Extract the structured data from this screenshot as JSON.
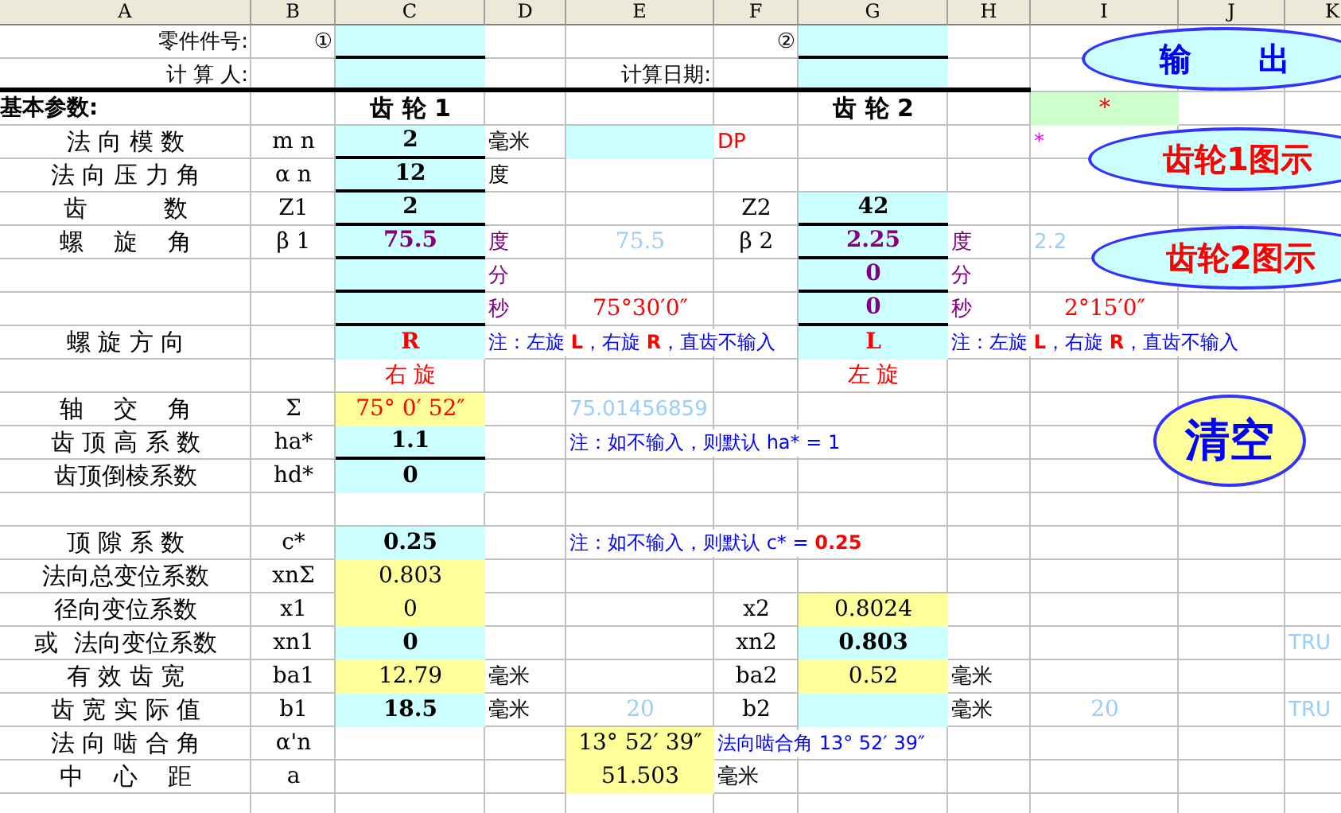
{
  "columns": [
    "A",
    "B",
    "C",
    "D",
    "E",
    "F",
    "G",
    "H",
    "I",
    "J",
    "K"
  ],
  "rows": [
    {
      "cells": [
        {
          "kind": "caption",
          "text": "零件件号:"
        },
        {
          "kind": "caption",
          "text": "①"
        },
        {
          "input": true,
          "ruled": true
        },
        null,
        null,
        {
          "kind": "caption",
          "text": "②"
        },
        {
          "input": true,
          "ruled": true
        }
      ]
    },
    {
      "thick": true,
      "cells": [
        {
          "kind": "caption",
          "text": "计 算 人:"
        },
        null,
        {
          "input": true
        },
        null,
        {
          "kind": "caption",
          "text": "计算日期:"
        },
        null,
        {
          "input": true
        }
      ]
    },
    {
      "cells": [
        {
          "kind": "heading",
          "text": "基本参数:"
        },
        null,
        {
          "kind": "title",
          "text": "齿 轮 1"
        },
        null,
        null,
        null,
        {
          "kind": "title",
          "text": "齿 轮 2"
        },
        null,
        {
          "kind": "value",
          "highlighted": true,
          "color": "#ff0000",
          "text": "*"
        }
      ]
    },
    {
      "cells": [
        {
          "kind": "label",
          "text": "法 向 模 数"
        },
        {
          "kind": "symbol",
          "text": "m n"
        },
        {
          "kind": "value",
          "input": true,
          "ruled": true,
          "bold": true,
          "text": "2"
        },
        {
          "kind": "unit",
          "text": "毫米"
        },
        {
          "input": true
        },
        {
          "kind": "unit",
          "color": "#ff0000",
          "text": "DP"
        },
        null,
        null,
        {
          "kind": "unit",
          "color": "#ff00ff",
          "text": "*"
        }
      ]
    },
    {
      "cells": [
        {
          "kind": "label",
          "text": "法 向 压 力 角"
        },
        {
          "kind": "symbol",
          "text": "α n"
        },
        {
          "kind": "value",
          "input": true,
          "ruled": true,
          "bold": true,
          "text": "12"
        },
        {
          "kind": "unit",
          "text": "度"
        }
      ]
    },
    {
      "cells": [
        {
          "kind": "label",
          "text": "齿          数"
        },
        {
          "kind": "symbol",
          "text": "Z1"
        },
        {
          "kind": "value",
          "input": true,
          "ruled": true,
          "bold": true,
          "text": "2"
        },
        null,
        null,
        {
          "kind": "symbol",
          "text": "Z2"
        },
        {
          "kind": "value",
          "input": true,
          "ruled": true,
          "bold": true,
          "text": "42"
        }
      ]
    },
    {
      "cells": [
        {
          "kind": "label",
          "text": "螺    旋    角"
        },
        {
          "kind": "symbol",
          "text": "β 1"
        },
        {
          "kind": "value",
          "input": true,
          "ruled": true,
          "bold": true,
          "color": "#800080",
          "text": "75.5"
        },
        {
          "kind": "unit",
          "color": "#800080",
          "text": "度"
        },
        {
          "kind": "value",
          "color": "#99ccff",
          "text": "75.5"
        },
        {
          "kind": "symbol",
          "text": "β 2"
        },
        {
          "kind": "value",
          "input": true,
          "ruled": true,
          "bold": true,
          "color": "#800080",
          "text": "2.25"
        },
        {
          "kind": "unit",
          "color": "#800080",
          "text": "度"
        },
        {
          "kind": "overflow",
          "color": "#99ccff",
          "text": "2.2"
        }
      ]
    },
    {
      "cells": [
        null,
        null,
        {
          "input": true,
          "ruled": true
        },
        {
          "kind": "unit",
          "color": "#800080",
          "text": "分"
        },
        null,
        null,
        {
          "kind": "value",
          "input": true,
          "ruled": true,
          "bold": true,
          "color": "#800080",
          "text": "0"
        },
        {
          "kind": "unit",
          "color": "#800080",
          "text": "分"
        }
      ]
    },
    {
      "cells": [
        null,
        null,
        {
          "input": true,
          "ruled": true
        },
        {
          "kind": "unit",
          "color": "#800080",
          "text": "秒"
        },
        {
          "kind": "value",
          "color": "#ff0000",
          "text": "75°30′0″"
        },
        null,
        {
          "kind": "value",
          "input": true,
          "ruled": true,
          "bold": true,
          "color": "#800080",
          "text": "0"
        },
        {
          "kind": "unit",
          "color": "#800080",
          "text": "秒"
        },
        {
          "kind": "value",
          "color": "#ff0000",
          "text": "2°15′0″"
        }
      ]
    },
    {
      "cells": [
        {
          "kind": "label",
          "text": "螺 旋 方 向"
        },
        null,
        {
          "kind": "value",
          "input": true,
          "bold": true,
          "color": "#ff0000",
          "text": "R"
        },
        {
          "kind": "note",
          "color": "#0000ff",
          "text": "注：左旋 **L**，右旋 **R**，直齿不输入"
        },
        null,
        null,
        {
          "kind": "value",
          "input": true,
          "bold": true,
          "color": "#ff0000",
          "text": "L"
        },
        {
          "kind": "note",
          "color": "#0000ff",
          "text": "注：左旋 **L**，右旋 **R**，直齿不输入"
        }
      ]
    },
    {
      "cells": [
        null,
        null,
        {
          "kind": "value",
          "color": "#ff0000",
          "text": "右 旋"
        },
        null,
        null,
        null,
        {
          "kind": "value",
          "color": "#ff0000",
          "text": "左 旋"
        }
      ]
    },
    {
      "cells": [
        {
          "kind": "label",
          "text": "轴    交    角"
        },
        {
          "kind": "symbol",
          "text": "Σ"
        },
        {
          "kind": "value",
          "computed": true,
          "color": "#ff0000",
          "text": "75° 0′ 52″"
        },
        null,
        {
          "kind": "overflow",
          "color": "#99ccff",
          "text": "75.01456859"
        }
      ]
    },
    {
      "cells": [
        {
          "kind": "label",
          "text": "齿 顶 高 系 数"
        },
        {
          "kind": "symbol",
          "text": "ha*"
        },
        {
          "kind": "value",
          "input": true,
          "ruled": true,
          "bold": true,
          "text": "1.1"
        },
        null,
        {
          "kind": "note",
          "color": "#0000ff",
          "text": "注：如不输入，则默认 ha* = 1"
        }
      ]
    },
    {
      "cells": [
        {
          "kind": "label",
          "text": "齿顶倒棱系数"
        },
        {
          "kind": "symbol",
          "text": "hd*"
        },
        {
          "kind": "value",
          "input": true,
          "bold": true,
          "text": "0"
        }
      ]
    },
    {},
    {
      "cells": [
        {
          "kind": "label",
          "text": "顶 隙 系 数"
        },
        {
          "kind": "symbol",
          "text": "c*"
        },
        {
          "kind": "value",
          "input": true,
          "bold": true,
          "text": "0.25"
        },
        null,
        {
          "kind": "note",
          "color": "#0000ff",
          "text": "注：如不输入，则默认 c* = **0.25**"
        }
      ]
    },
    {
      "cells": [
        {
          "kind": "label",
          "text": "法向总变位系数"
        },
        {
          "kind": "symbol",
          "text": "xnΣ"
        },
        {
          "kind": "value",
          "computed": true,
          "text": "0.803"
        }
      ]
    },
    {
      "cells": [
        {
          "kind": "label",
          "text": "径向变位系数"
        },
        {
          "kind": "symbol",
          "text": "x1"
        },
        {
          "kind": "value",
          "computed": true,
          "text": "0"
        },
        null,
        null,
        {
          "kind": "symbol",
          "text": "x2"
        },
        {
          "kind": "value",
          "computed": true,
          "text": "0.8024"
        }
      ]
    },
    {
      "cells": [
        {
          "kind": "label",
          "text": "或  法向变位系数"
        },
        {
          "kind": "symbol",
          "text": "xn1"
        },
        {
          "kind": "value",
          "input": true,
          "bold": true,
          "text": "0"
        },
        null,
        null,
        {
          "kind": "symbol",
          "text": "xn2"
        },
        {
          "kind": "value",
          "input": true,
          "bold": true,
          "text": "0.803"
        },
        null,
        null,
        null,
        {
          "kind": "overflow",
          "color": "#99ccff",
          "text": "TRU"
        }
      ]
    },
    {
      "cells": [
        {
          "kind": "label",
          "text": "有 效 齿 宽"
        },
        {
          "kind": "symbol",
          "text": "ba1"
        },
        {
          "kind": "value",
          "computed": true,
          "text": "12.79"
        },
        {
          "kind": "unit",
          "text": "毫米"
        },
        null,
        {
          "kind": "symbol",
          "text": "ba2"
        },
        {
          "kind": "value",
          "computed": true,
          "text": "0.52"
        },
        {
          "kind": "unit",
          "text": "毫米"
        }
      ]
    },
    {
      "cells": [
        {
          "kind": "label",
          "text": "齿 宽 实 际 值"
        },
        {
          "kind": "symbol",
          "text": "b1"
        },
        {
          "kind": "value",
          "input": true,
          "bold": true,
          "text": "18.5"
        },
        {
          "kind": "unit",
          "text": "毫米"
        },
        {
          "kind": "value",
          "color": "#99ccff",
          "text": "20"
        },
        {
          "kind": "symbol",
          "text": "b2"
        },
        {
          "input": true
        },
        {
          "kind": "unit",
          "text": "毫米"
        },
        {
          "kind": "value",
          "color": "#99ccff",
          "text": "20"
        },
        null,
        {
          "kind": "overflow",
          "color": "#99ccff",
          "text": "TRU"
        }
      ]
    },
    {
      "cells": [
        {
          "kind": "label",
          "text": "法 向 啮 合 角"
        },
        {
          "kind": "symbol",
          "text": "α'n"
        },
        null,
        null,
        {
          "kind": "value",
          "computed": true,
          "text": "13° 52′ 39″"
        },
        {
          "kind": "note",
          "color": "#0000ff",
          "text": "法向啮合角 13° 52′ 39″"
        }
      ]
    },
    {
      "cells": [
        {
          "kind": "label",
          "text": "中    心    距"
        },
        {
          "kind": "symbol",
          "text": "a"
        },
        null,
        null,
        {
          "kind": "value",
          "computed": true,
          "text": "51.503"
        },
        {
          "kind": "unit",
          "text": "毫米"
        }
      ]
    },
    {}
  ],
  "buttons": [
    {
      "kind": "output",
      "label": "输      出"
    },
    {
      "kind": "diagram",
      "label": "齿轮1图示"
    },
    {
      "kind": "diagram",
      "label": "齿轮2图示"
    },
    {
      "kind": "clear",
      "label": "清空"
    }
  ]
}
